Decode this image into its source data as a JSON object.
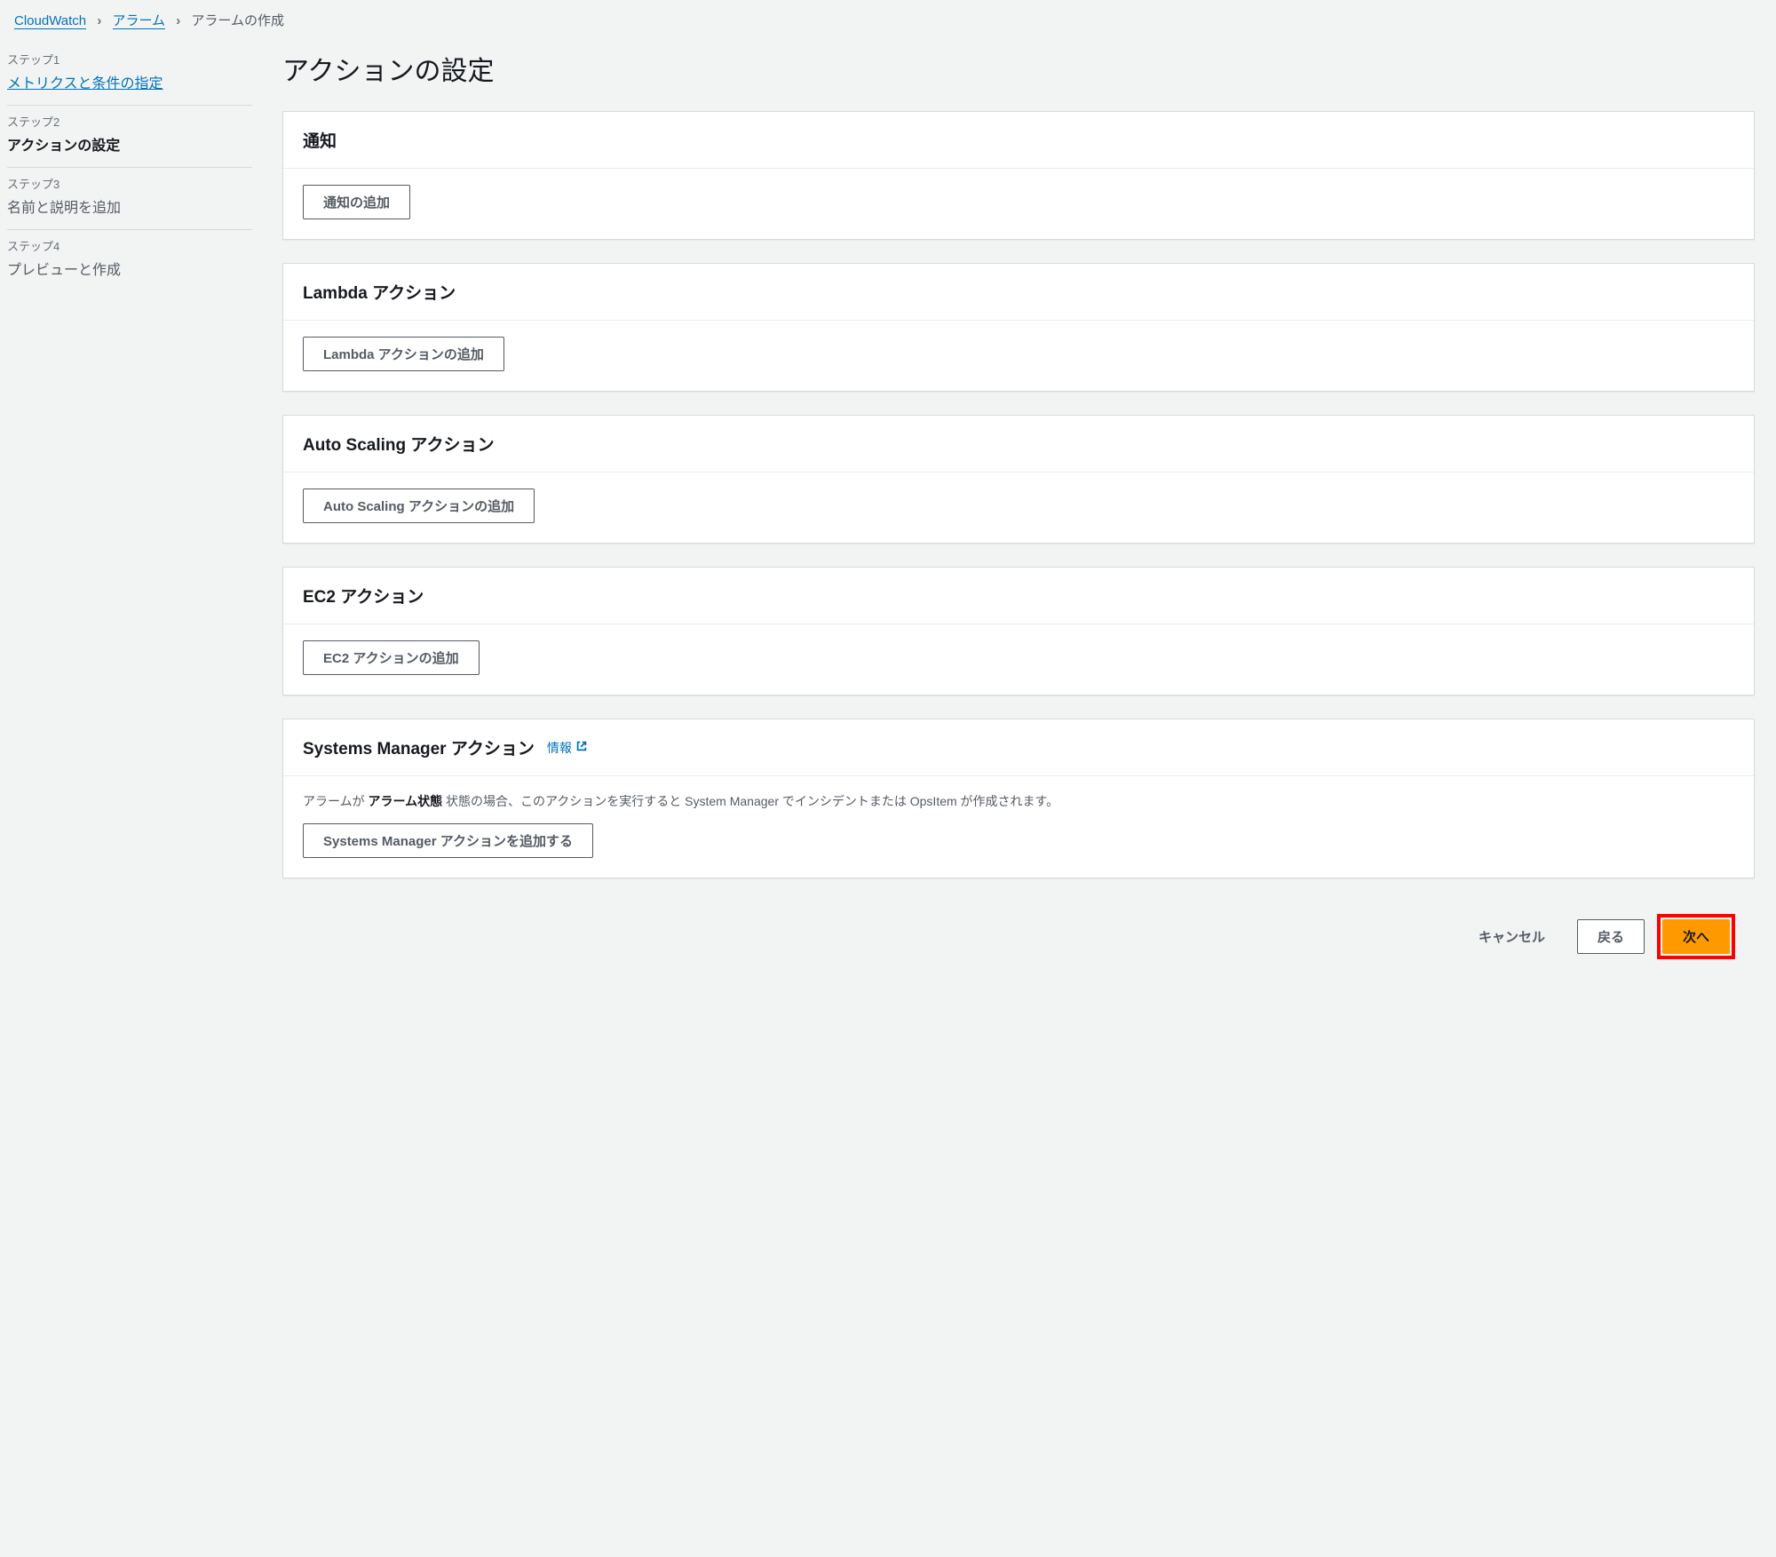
{
  "breadcrumb": {
    "root": "CloudWatch",
    "alarms": "アラーム",
    "current": "アラームの作成"
  },
  "steps": [
    {
      "label": "ステップ1",
      "title": "メトリクスと条件の指定"
    },
    {
      "label": "ステップ2",
      "title": "アクションの設定"
    },
    {
      "label": "ステップ3",
      "title": "名前と説明を追加"
    },
    {
      "label": "ステップ4",
      "title": "プレビューと作成"
    }
  ],
  "page_title": "アクションの設定",
  "sections": {
    "notification": {
      "title": "通知",
      "add_button": "通知の追加"
    },
    "lambda": {
      "title": "Lambda アクション",
      "add_button": "Lambda アクションの追加"
    },
    "autoscaling": {
      "title": "Auto Scaling アクション",
      "add_button": "Auto Scaling アクションの追加"
    },
    "ec2": {
      "title": "EC2 アクション",
      "add_button": "EC2 アクションの追加"
    },
    "systems_manager": {
      "title": "Systems Manager アクション",
      "info_label": "情報",
      "desc_prefix": "アラームが ",
      "desc_bold": "アラーム状態",
      "desc_suffix": " 状態の場合、このアクションを実行すると System Manager でインシデントまたは OpsItem が作成されます。",
      "add_button": "Systems Manager アクションを追加する"
    }
  },
  "footer": {
    "cancel": "キャンセル",
    "back": "戻る",
    "next": "次へ"
  }
}
